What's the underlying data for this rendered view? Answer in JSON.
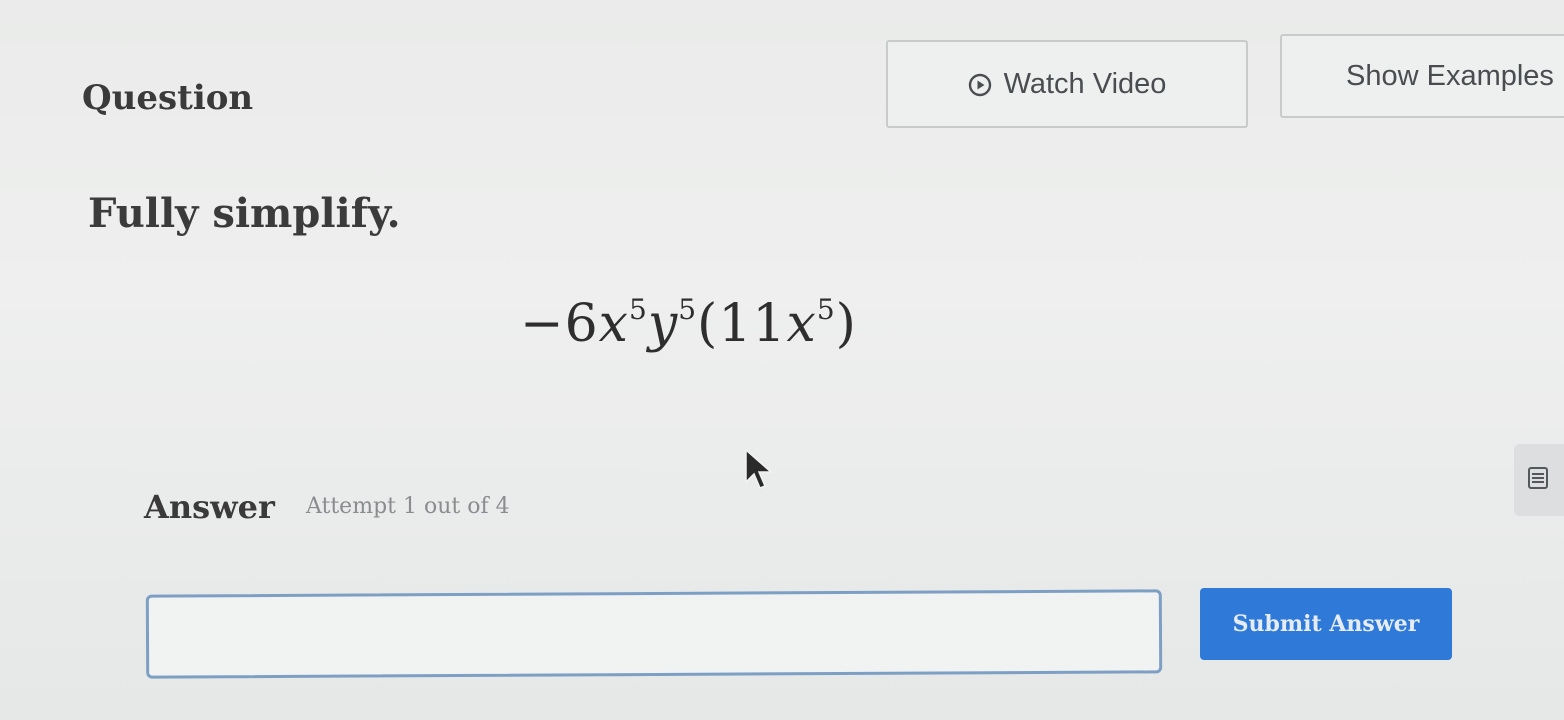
{
  "header": {
    "title": "Question",
    "watch_video_label": "Watch Video",
    "show_examples_label": "Show Examples"
  },
  "problem": {
    "instruction": "Fully simplify.",
    "coefficient": "−6",
    "var1": "x",
    "exp1": "5",
    "var2": "y",
    "exp2": "5",
    "inner_open": "(11",
    "var3": "x",
    "exp3": "5",
    "inner_close": ")"
  },
  "answer": {
    "label": "Answer",
    "attempt": "Attempt 1 out of 4",
    "input_value": "",
    "submit_label": "Submit Answer"
  },
  "colors": {
    "submit_bg": "#2f7ad9",
    "input_border": "#7d9fc4"
  },
  "icons": {
    "watch_video": "play-circle-icon",
    "side_tab": "menu-icon",
    "cursor": "mouse-pointer-icon"
  }
}
